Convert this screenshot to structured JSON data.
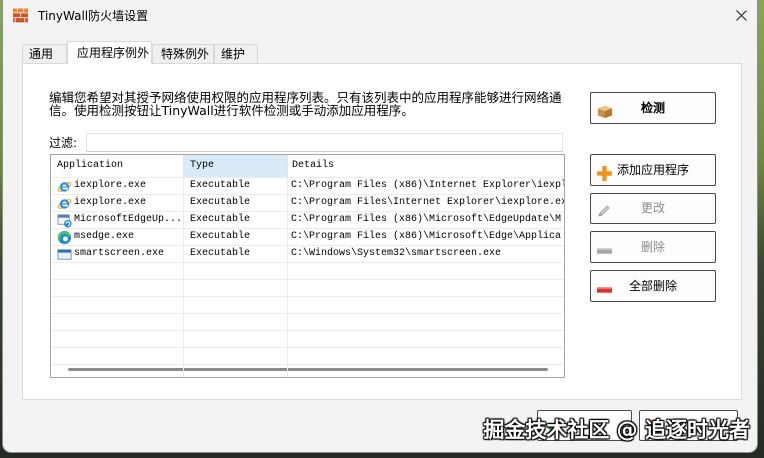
{
  "window": {
    "title": "TinyWall防火墙设置",
    "app_icon": "brick-wall-icon",
    "close_icon": "close-icon"
  },
  "tabs": [
    {
      "label": "通用",
      "selected": false
    },
    {
      "label": "应用程序例外",
      "selected": true
    },
    {
      "label": "特殊例外",
      "selected": false
    },
    {
      "label": "维护",
      "selected": false
    }
  ],
  "description": {
    "line1": "编辑您希望对其授予网络使用权限的应用程序列表。只有该列表中的应用程序能够进行网络通",
    "line2": "信。使用检测按钮让TinyWall进行软件检测或手动添加应用程序。"
  },
  "filter": {
    "label": "过滤:"
  },
  "table": {
    "columns": {
      "application": "Application",
      "type": "Type",
      "details": "Details"
    },
    "highlighted_column": "type",
    "rows": [
      {
        "icon": "internet-explorer-icon",
        "app": "iexplore.exe",
        "type": "Executable",
        "details": "C:\\Program Files (x86)\\Internet Explorer\\iexpl"
      },
      {
        "icon": "internet-explorer-icon",
        "app": "iexplore.exe",
        "type": "Executable",
        "details": "C:\\Program Files\\Internet Explorer\\iexplore.ex"
      },
      {
        "icon": "edge-update-icon",
        "app": "MicrosoftEdgeUp...",
        "type": "Executable",
        "details": "C:\\Program Files (x86)\\Microsoft\\EdgeUpdate\\M"
      },
      {
        "icon": "edge-icon",
        "app": "msedge.exe",
        "type": "Executable",
        "details": "C:\\Program Files (x86)\\Microsoft\\Edge\\Applica"
      },
      {
        "icon": "application-window-icon",
        "app": "smartscreen.exe",
        "type": "Executable",
        "details": "C:\\Windows\\System32\\smartscreen.exe"
      }
    ]
  },
  "buttons": {
    "detect": {
      "label": "检测",
      "icon": "package-box-icon",
      "bold": true,
      "disabled": false
    },
    "add": {
      "label": "添加应用程序",
      "icon": "plus-icon",
      "bold": false,
      "disabled": false
    },
    "modify": {
      "label": "更改",
      "icon": "pencil-icon",
      "bold": false,
      "disabled": true
    },
    "remove": {
      "label": "删除",
      "icon": "minus-icon",
      "bold": false,
      "disabled": true
    },
    "remove_all": {
      "label": "全部删除",
      "icon": "red-minus-icon",
      "bold": false,
      "disabled": false
    }
  },
  "footer": {
    "ok_icon": "green-check-icon",
    "cancel_icon": "cancel-icon"
  },
  "watermark": {
    "text": "掘金技术社区 @ 追逐时光者"
  },
  "colors": {
    "window_bg": "#f3f3f3",
    "column_highlight": "#d9ebf9",
    "add_icon": "#f0921e",
    "remove_all_icon": "#e0322c",
    "ok_icon": "#2ea043"
  }
}
